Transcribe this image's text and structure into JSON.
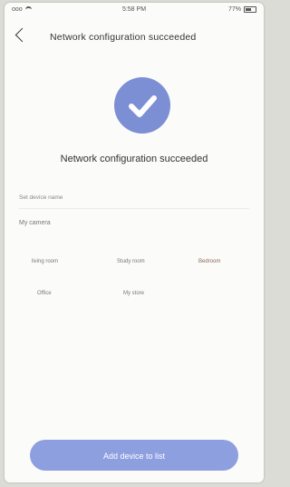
{
  "status_bar": {
    "carrier": "ooo",
    "time": "5:58 PM",
    "battery_percent": "77%"
  },
  "nav": {
    "title": "Network configuration succeeded"
  },
  "main": {
    "success_message": "Network configuration succeeded",
    "device_name_placeholder": "Set device name",
    "section_label": "My camera",
    "locations": [
      "living room",
      "Study room",
      "Bedroom",
      "Office",
      "My store"
    ]
  },
  "footer": {
    "add_button_label": "Add device to list"
  },
  "colors": {
    "accent": "#7d8fd4",
    "button": "#8e9fe0",
    "background": "#fbfbfa"
  }
}
